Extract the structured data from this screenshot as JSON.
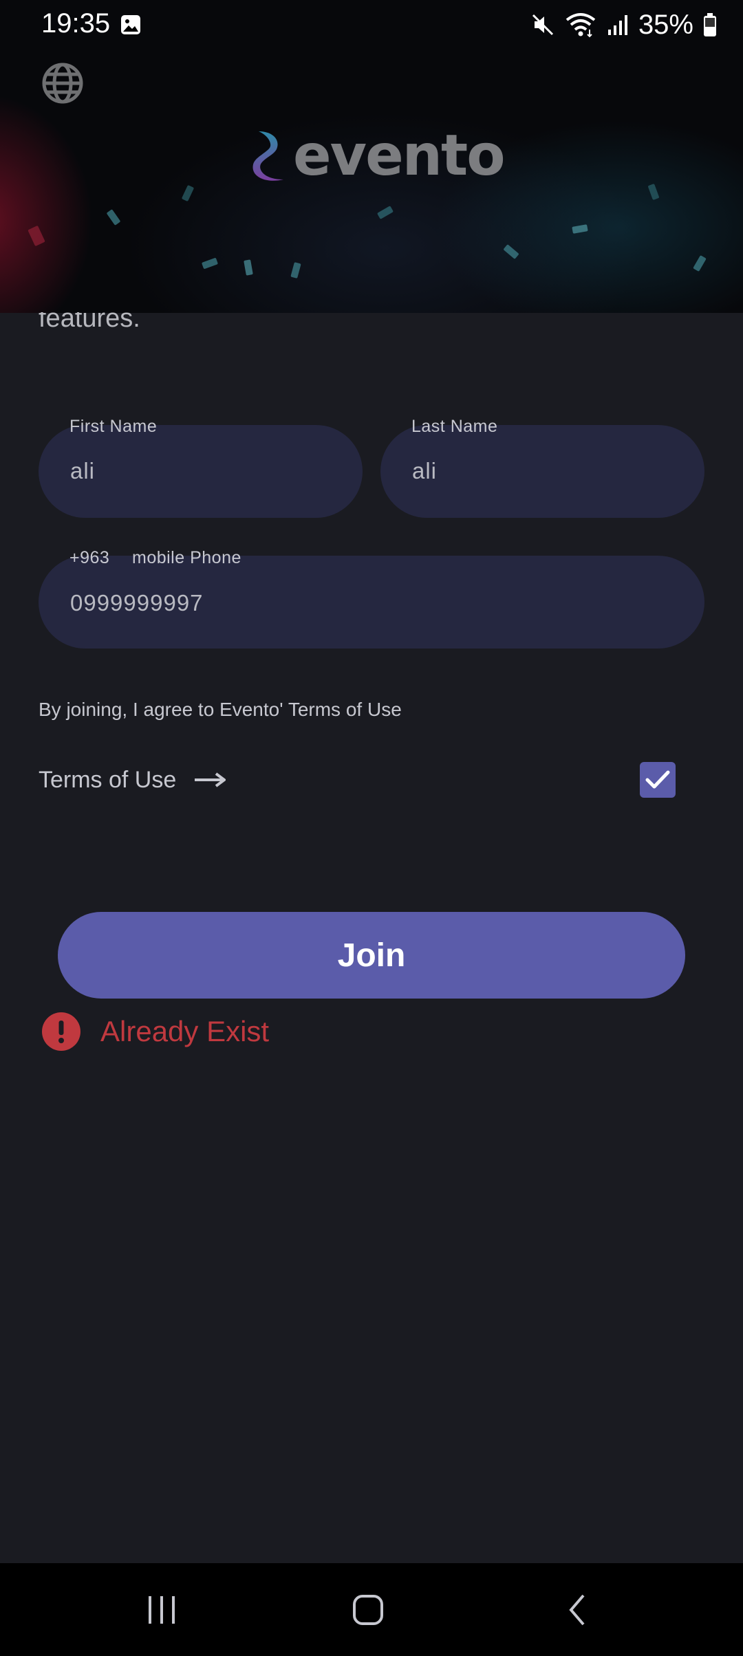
{
  "status_bar": {
    "time": "19:35",
    "battery": "35%",
    "icons": [
      "gallery-icon",
      "mute-icon",
      "wifi-icon",
      "signal-icon",
      "battery-icon"
    ]
  },
  "header": {
    "logo_text": "evento",
    "language_icon": "globe-icon"
  },
  "scrolled_text": "features.",
  "form": {
    "first_name": {
      "label": "First Name",
      "value": "ali"
    },
    "last_name": {
      "label": "Last Name",
      "value": "ali"
    },
    "phone": {
      "country_code": "+963",
      "label": "mobile Phone",
      "value": "0999999997"
    }
  },
  "agreement": {
    "text": "By joining, I agree to Evento' Terms of Use",
    "terms_link": "Terms of Use",
    "checked": true
  },
  "join_button": "Join",
  "error": {
    "text": "Already Exist",
    "icon": "error-icon"
  },
  "colors": {
    "background": "#1a1b21",
    "field": "#252740",
    "accent": "#5b5caa",
    "error": "#c0393f"
  },
  "navigation_bar": [
    "recent-apps",
    "home",
    "back"
  ]
}
